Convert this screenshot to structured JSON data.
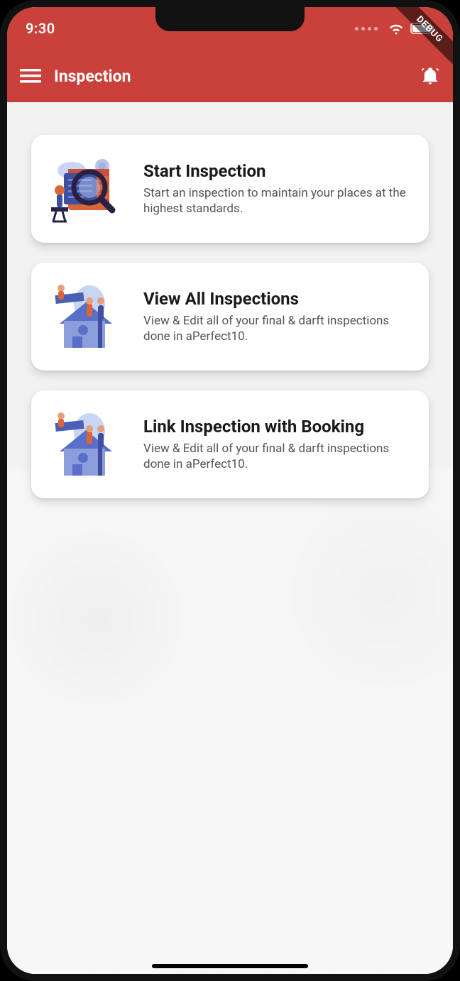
{
  "status": {
    "time": "9:30",
    "debug_ribbon": "DEBUG"
  },
  "appbar": {
    "title": "Inspection"
  },
  "cards": [
    {
      "title": "Start Inspection",
      "description": "Start an inspection to maintain your places at the highest standards."
    },
    {
      "title": "View All Inspections",
      "description": "View & Edit all of your final & darft inspections done in aPerfect10."
    },
    {
      "title": "Link Inspection with Booking",
      "description": "View & Edit all of your final & darft inspections done in aPerfect10."
    }
  ]
}
